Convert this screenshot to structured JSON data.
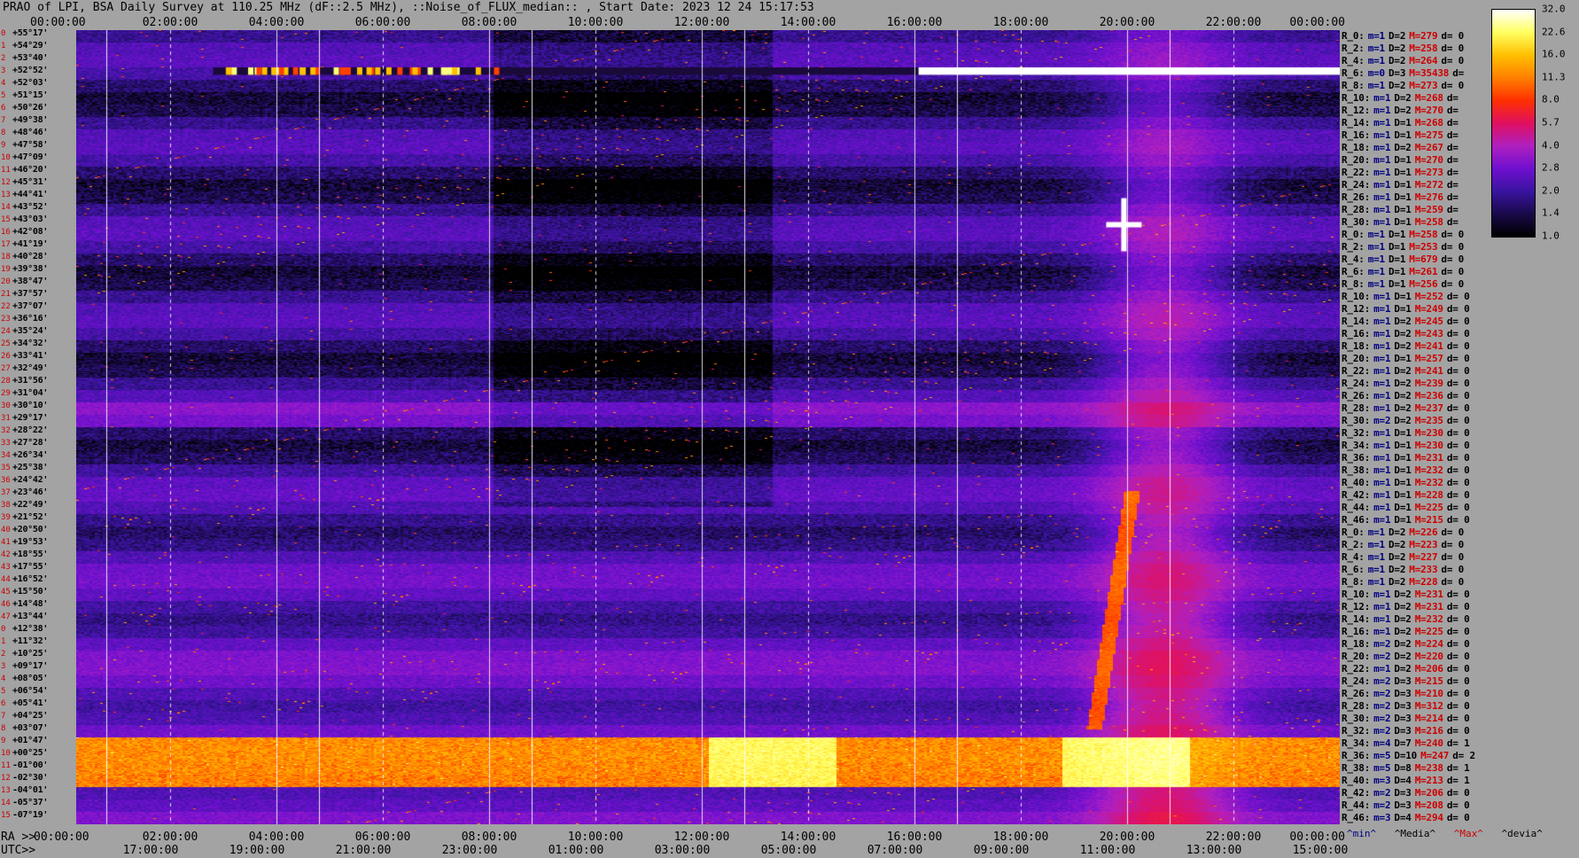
{
  "title": "PRAO of LPI, BSA Daily Survey at 110.25 MHz (dF::2.5 MHz), ::Noise_of_FLUX_median:: , Start Date: 2023 12 24 15:17:53",
  "top_ticks": [
    "00:00:00",
    "02:00:00",
    "04:00:00",
    "06:00:00",
    "08:00:00",
    "10:00:00",
    "12:00:00",
    "14:00:00",
    "16:00:00",
    "18:00:00",
    "20:00:00",
    "22:00:00",
    "00:00:00"
  ],
  "ra_axis": {
    "prefix": "RA >>",
    "ticks": [
      "00:00:00",
      "02:00:00",
      "04:00:00",
      "06:00:00",
      "08:00:00",
      "10:00:00",
      "12:00:00",
      "14:00:00",
      "16:00:00",
      "18:00:00",
      "20:00:00",
      "22:00:00",
      "00:00:00"
    ]
  },
  "utc_axis": {
    "prefix": "UTC>>",
    "ticks": [
      "17:00:00",
      "19:00:00",
      "21:00:00",
      "23:00:00",
      "01:00:00",
      "03:00:00",
      "05:00:00",
      "07:00:00",
      "09:00:00",
      "11:00:00",
      "13:00:00",
      "15:00:00"
    ]
  },
  "declinations": [
    "+55°17'",
    "+54°29'",
    "+53°40'",
    "+52°52'",
    "+52°03'",
    "+51°15'",
    "+50°26'",
    "+49°38'",
    "+48°46'",
    "+47°58'",
    "+47°09'",
    "+46°20'",
    "+45°31'",
    "+44°41'",
    "+43°52'",
    "+43°03'",
    "+42°08'",
    "+41°19'",
    "+40°28'",
    "+39°38'",
    "+38°47'",
    "+37°57'",
    "+37°07'",
    "+36°16'",
    "+35°24'",
    "+34°32'",
    "+33°41'",
    "+32°49'",
    "+31°56'",
    "+31°04'",
    "+30°10'",
    "+29°17'",
    "+28°22'",
    "+27°28'",
    "+26°34'",
    "+25°38'",
    "+24°42'",
    "+23°46'",
    "+22°49'",
    "+21°52'",
    "+20°50'",
    "+19°53'",
    "+18°55'",
    "+17°55'",
    "+16°52'",
    "+15°50'",
    "+14°48'",
    "+13°44'",
    "+12°38'",
    "+11°32'",
    "+10°25'",
    "+09°17'",
    "+08°05'",
    "+06°54'",
    "+05°41'",
    "+04°25'",
    "+03°07'",
    "+01°47'",
    "+00°25'",
    "-01°00'",
    "-02°30'",
    "-04°01'",
    "-05°37'",
    "-07°19'"
  ],
  "stats": [
    {
      "n": "R_0:",
      "m": "m=1",
      "d": "D=2",
      "M": "M=279",
      "dd": "d= 0"
    },
    {
      "n": "R_2:",
      "m": "m=1",
      "d": "D=2",
      "M": "M=258",
      "dd": "d= 0"
    },
    {
      "n": "R_4:",
      "m": "m=1",
      "d": "D=2",
      "M": "M=264",
      "dd": "d= 0"
    },
    {
      "n": "R_6:",
      "m": "m=0",
      "d": "D=3",
      "M": "M=35438",
      "dd": "d="
    },
    {
      "n": "R_8:",
      "m": "m=1",
      "d": "D=2",
      "M": "M=273",
      "dd": "d= 0"
    },
    {
      "n": "R_10:",
      "m": "m=1",
      "d": "D=2",
      "M": "M=268",
      "dd": "d="
    },
    {
      "n": "R_12:",
      "m": "m=1",
      "d": "D=2",
      "M": "M=270",
      "dd": "d="
    },
    {
      "n": "R_14:",
      "m": "m=1",
      "d": "D=1",
      "M": "M=268",
      "dd": "d="
    },
    {
      "n": "R_16:",
      "m": "m=1",
      "d": "D=1",
      "M": "M=275",
      "dd": "d="
    },
    {
      "n": "R_18:",
      "m": "m=1",
      "d": "D=2",
      "M": "M=267",
      "dd": "d="
    },
    {
      "n": "R_20:",
      "m": "m=1",
      "d": "D=1",
      "M": "M=270",
      "dd": "d="
    },
    {
      "n": "R_22:",
      "m": "m=1",
      "d": "D=1",
      "M": "M=273",
      "dd": "d="
    },
    {
      "n": "R_24:",
      "m": "m=1",
      "d": "D=1",
      "M": "M=272",
      "dd": "d="
    },
    {
      "n": "R_26:",
      "m": "m=1",
      "d": "D=1",
      "M": "M=276",
      "dd": "d="
    },
    {
      "n": "R_28:",
      "m": "m=1",
      "d": "D=1",
      "M": "M=259",
      "dd": "d="
    },
    {
      "n": "R_30:",
      "m": "m=1",
      "d": "D=1",
      "M": "M=258",
      "dd": "d="
    },
    {
      "n": "R_0:",
      "m": "m=1",
      "d": "D=1",
      "M": "M=258",
      "dd": "d= 0"
    },
    {
      "n": "R_2:",
      "m": "m=1",
      "d": "D=1",
      "M": "M=253",
      "dd": "d= 0"
    },
    {
      "n": "R_4:",
      "m": "m=1",
      "d": "D=1",
      "M": "M=679",
      "dd": "d= 0"
    },
    {
      "n": "R_6:",
      "m": "m=1",
      "d": "D=1",
      "M": "M=261",
      "dd": "d= 0"
    },
    {
      "n": "R_8:",
      "m": "m=1",
      "d": "D=1",
      "M": "M=256",
      "dd": "d= 0"
    },
    {
      "n": "R_10:",
      "m": "m=1",
      "d": "D=1",
      "M": "M=252",
      "dd": "d= 0"
    },
    {
      "n": "R_12:",
      "m": "m=1",
      "d": "D=1",
      "M": "M=249",
      "dd": "d= 0"
    },
    {
      "n": "R_14:",
      "m": "m=1",
      "d": "D=2",
      "M": "M=245",
      "dd": "d= 0"
    },
    {
      "n": "R_16:",
      "m": "m=1",
      "d": "D=2",
      "M": "M=243",
      "dd": "d= 0"
    },
    {
      "n": "R_18:",
      "m": "m=1",
      "d": "D=2",
      "M": "M=241",
      "dd": "d= 0"
    },
    {
      "n": "R_20:",
      "m": "m=1",
      "d": "D=1",
      "M": "M=257",
      "dd": "d= 0"
    },
    {
      "n": "R_22:",
      "m": "m=1",
      "d": "D=2",
      "M": "M=241",
      "dd": "d= 0"
    },
    {
      "n": "R_24:",
      "m": "m=1",
      "d": "D=2",
      "M": "M=239",
      "dd": "d= 0"
    },
    {
      "n": "R_26:",
      "m": "m=1",
      "d": "D=2",
      "M": "M=236",
      "dd": "d= 0"
    },
    {
      "n": "R_28:",
      "m": "m=1",
      "d": "D=2",
      "M": "M=237",
      "dd": "d= 0"
    },
    {
      "n": "R_30:",
      "m": "m=2",
      "d": "D=2",
      "M": "M=235",
      "dd": "d= 0"
    },
    {
      "n": "R_32:",
      "m": "m=1",
      "d": "D=1",
      "M": "M=230",
      "dd": "d= 0"
    },
    {
      "n": "R_34:",
      "m": "m=1",
      "d": "D=1",
      "M": "M=230",
      "dd": "d= 0"
    },
    {
      "n": "R_36:",
      "m": "m=1",
      "d": "D=1",
      "M": "M=231",
      "dd": "d= 0"
    },
    {
      "n": "R_38:",
      "m": "m=1",
      "d": "D=1",
      "M": "M=232",
      "dd": "d= 0"
    },
    {
      "n": "R_40:",
      "m": "m=1",
      "d": "D=1",
      "M": "M=232",
      "dd": "d= 0"
    },
    {
      "n": "R_42:",
      "m": "m=1",
      "d": "D=1",
      "M": "M=228",
      "dd": "d= 0"
    },
    {
      "n": "R_44:",
      "m": "m=1",
      "d": "D=1",
      "M": "M=225",
      "dd": "d= 0"
    },
    {
      "n": "R_46:",
      "m": "m=1",
      "d": "D=1",
      "M": "M=215",
      "dd": "d= 0"
    },
    {
      "n": "R_0:",
      "m": "m=1",
      "d": "D=2",
      "M": "M=226",
      "dd": "d= 0"
    },
    {
      "n": "R_2:",
      "m": "m=1",
      "d": "D=2",
      "M": "M=223",
      "dd": "d= 0"
    },
    {
      "n": "R_4:",
      "m": "m=1",
      "d": "D=2",
      "M": "M=227",
      "dd": "d= 0"
    },
    {
      "n": "R_6:",
      "m": "m=1",
      "d": "D=2",
      "M": "M=233",
      "dd": "d= 0"
    },
    {
      "n": "R_8:",
      "m": "m=1",
      "d": "D=2",
      "M": "M=228",
      "dd": "d= 0"
    },
    {
      "n": "R_10:",
      "m": "m=1",
      "d": "D=2",
      "M": "M=231",
      "dd": "d= 0"
    },
    {
      "n": "R_12:",
      "m": "m=1",
      "d": "D=2",
      "M": "M=231",
      "dd": "d= 0"
    },
    {
      "n": "R_14:",
      "m": "m=1",
      "d": "D=2",
      "M": "M=232",
      "dd": "d= 0"
    },
    {
      "n": "R_16:",
      "m": "m=1",
      "d": "D=2",
      "M": "M=225",
      "dd": "d= 0"
    },
    {
      "n": "R_18:",
      "m": "m=2",
      "d": "D=2",
      "M": "M=224",
      "dd": "d= 0"
    },
    {
      "n": "R_20:",
      "m": "m=2",
      "d": "D=2",
      "M": "M=220",
      "dd": "d= 0"
    },
    {
      "n": "R_22:",
      "m": "m=1",
      "d": "D=2",
      "M": "M=206",
      "dd": "d= 0"
    },
    {
      "n": "R_24:",
      "m": "m=2",
      "d": "D=3",
      "M": "M=215",
      "dd": "d= 0"
    },
    {
      "n": "R_26:",
      "m": "m=2",
      "d": "D=3",
      "M": "M=210",
      "dd": "d= 0"
    },
    {
      "n": "R_28:",
      "m": "m=2",
      "d": "D=3",
      "M": "M=312",
      "dd": "d= 0"
    },
    {
      "n": "R_30:",
      "m": "m=2",
      "d": "D=3",
      "M": "M=214",
      "dd": "d= 0"
    },
    {
      "n": "R_32:",
      "m": "m=2",
      "d": "D=3",
      "M": "M=216",
      "dd": "d= 0"
    },
    {
      "n": "R_34:",
      "m": "m=4",
      "d": "D=7",
      "M": "M=240",
      "dd": "d= 1"
    },
    {
      "n": "R_36:",
      "m": "m=5",
      "d": "D=10",
      "M": "M=247",
      "dd": "d= 2"
    },
    {
      "n": "R_38:",
      "m": "m=5",
      "d": "D=8",
      "M": "M=238",
      "dd": "d= 1"
    },
    {
      "n": "R_40:",
      "m": "m=3",
      "d": "D=4",
      "M": "M=213",
      "dd": "d= 1"
    },
    {
      "n": "R_42:",
      "m": "m=2",
      "d": "D=3",
      "M": "M=206",
      "dd": "d= 0"
    },
    {
      "n": "R_44:",
      "m": "m=2",
      "d": "D=3",
      "M": "M=208",
      "dd": "d= 0"
    },
    {
      "n": "R_46:",
      "m": "m=3",
      "d": "D=4",
      "M": "M=294",
      "dd": "d= 0"
    }
  ],
  "legend": {
    "min": "^min^",
    "median": "^Media^",
    "max": "^Max^",
    "devia": "^devia^"
  },
  "colorbar": {
    "ticks": [
      "32.0",
      "22.6",
      "16.0",
      "11.3",
      "8.0",
      "5.7",
      "4.0",
      "2.8",
      "2.0",
      "1.4",
      "1.0"
    ],
    "colors": [
      "#000000",
      "#1a0a4a",
      "#3a14a0",
      "#7010d0",
      "#b020c0",
      "#e01060",
      "#ff3000",
      "#ff8000",
      "#ffc000",
      "#ffff60",
      "#ffffff"
    ]
  },
  "chart_data": {
    "type": "heatmap",
    "title": "PRAO of LPI, BSA Daily Survey at 110.25 MHz (dF::2.5 MHz), ::Noise_of_FLUX_median:: , Start Date: 2023 12 24 15:17:53",
    "x_ra_hours": [
      0,
      24
    ],
    "x_ticks_ra": [
      "00:00:00",
      "02:00:00",
      "04:00:00",
      "06:00:00",
      "08:00:00",
      "10:00:00",
      "12:00:00",
      "14:00:00",
      "16:00:00",
      "18:00:00",
      "20:00:00",
      "22:00:00",
      "00:00:00"
    ],
    "x_ticks_utc": [
      "17:00:00",
      "19:00:00",
      "21:00:00",
      "23:00:00",
      "01:00:00",
      "03:00:00",
      "05:00:00",
      "07:00:00",
      "09:00:00",
      "11:00:00",
      "13:00:00",
      "15:00:00"
    ],
    "y_dec_range": [
      "+55°17'",
      "-07°19'"
    ],
    "color_scale": "log",
    "color_range": [
      1.0,
      32.0
    ],
    "features": [
      {
        "label": "R_6 saturated band",
        "ra_start": 16.0,
        "ra_end": 24.0,
        "dec": "+52°52'",
        "value": 32
      },
      {
        "label": "bright source",
        "ra": 19.9,
        "dec": "+40°44'",
        "value": 32
      },
      {
        "label": "equatorial band",
        "dec_from": "+01°47'",
        "dec_to": "-01°00'",
        "value": 11
      },
      {
        "label": "diagonal track",
        "ra_start": 18.5,
        "ra_end": 19.4,
        "dec_from": "+03°07'",
        "dec_to": "+20°50'",
        "value": 8
      }
    ]
  }
}
